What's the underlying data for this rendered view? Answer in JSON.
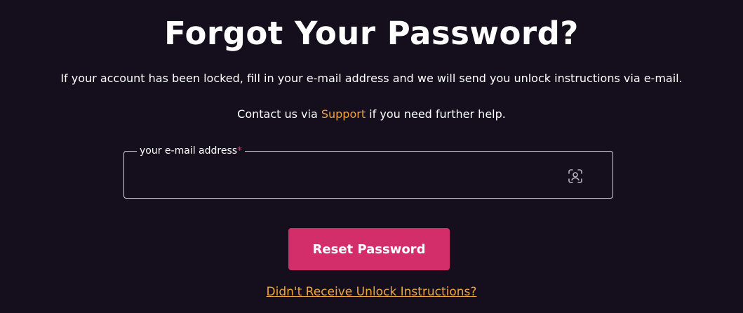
{
  "page": {
    "title": "Forgot Your Password?",
    "intro": "If your account has been locked, fill in your e-mail address and we will send you unlock instructions via e-mail.",
    "contact_prefix": "Contact us via ",
    "contact_link": "Support",
    "contact_suffix": " if you need further help."
  },
  "form": {
    "email_label": "your e-mail address",
    "required_marker": "*",
    "email_value": "",
    "email_icon": "face-id-icon",
    "reset_button": "Reset Password",
    "unlock_link": "Didn't Receive Unlock Instructions?"
  },
  "colors": {
    "background": "#150f1d",
    "accent": "#f0a43c",
    "button": "#d42e6a"
  }
}
